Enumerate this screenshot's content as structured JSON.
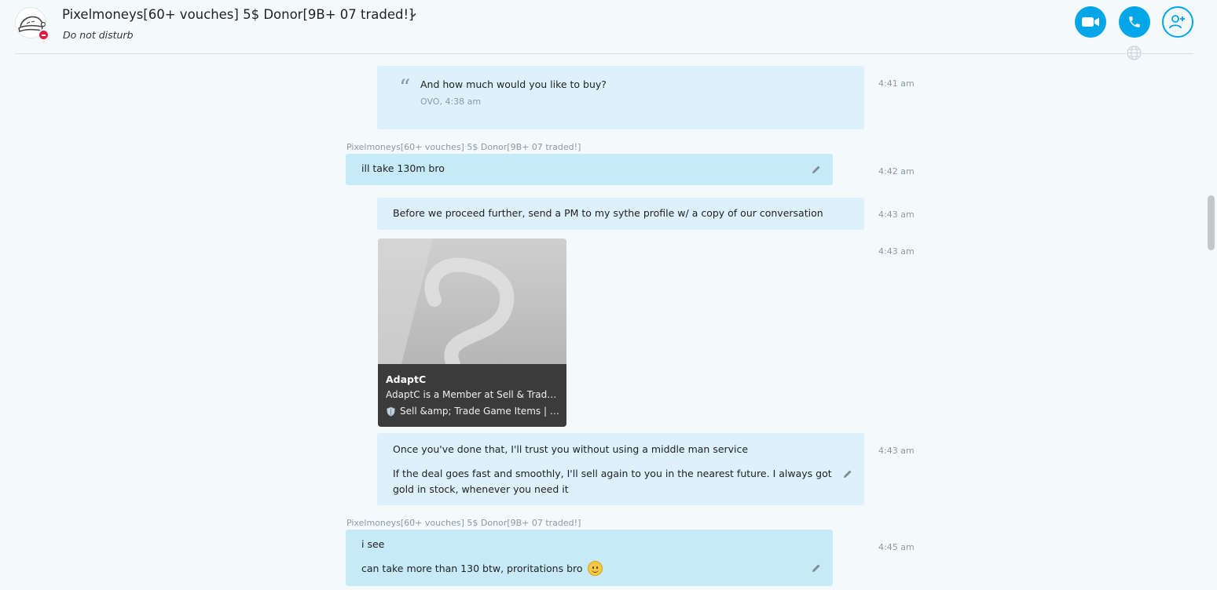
{
  "header": {
    "contact_name": "Pixelmoneys[60+ vouches] 5$ Donor[9B+ 07 traded!]",
    "presence": "Do not disturb",
    "status_color": "#e2183b",
    "accent_color": "#00a6e8",
    "buttons": {
      "video": "video-call-icon",
      "audio": "audio-call-icon",
      "add_people": "add-people-icon"
    }
  },
  "messages": [
    {
      "direction": "out",
      "quote": {
        "text": "And how much would you like to buy?",
        "meta": "OVO, 4:38 am"
      },
      "time": "4:41 am"
    },
    {
      "direction": "in",
      "sender": "Pixelmoneys[60+ vouches] 5$ Donor[9B+ 07 traded!]",
      "lines": [
        "ill take 130m bro"
      ],
      "time": "4:42 am",
      "edited": true
    },
    {
      "direction": "out",
      "lines": [
        "Before we proceed further, send a PM to my sythe profile w/ a copy of our conversation"
      ],
      "time": "4:43 am"
    },
    {
      "direction": "out",
      "link_preview": {
        "title": "AdaptC",
        "description": "AdaptC is a Member at Sell & Trade Game Items | RuneScape Gold, OSRS Gold, Accounts, Fortnite Accounts & Skins",
        "site": "Sell &amp; Trade Game Items | RuneScape Gold, OSRS Gold"
      },
      "time": "4:43 am"
    },
    {
      "direction": "out",
      "lines": [
        "Once you've done that, I'll trust you without using a middle man service",
        "If the deal goes fast and smoothly, I'll sell again to you in the nearest future. I always got gold in stock, whenever you need it"
      ],
      "time": "4:43 am",
      "edited": true
    },
    {
      "direction": "in",
      "sender": "Pixelmoneys[60+ vouches] 5$ Donor[9B+ 07 traded!]",
      "lines": [
        "i see",
        "can take more than 130 btw, proritations bro"
      ],
      "emoji": "smile-emoji",
      "time": "4:45 am",
      "edited": true
    }
  ]
}
